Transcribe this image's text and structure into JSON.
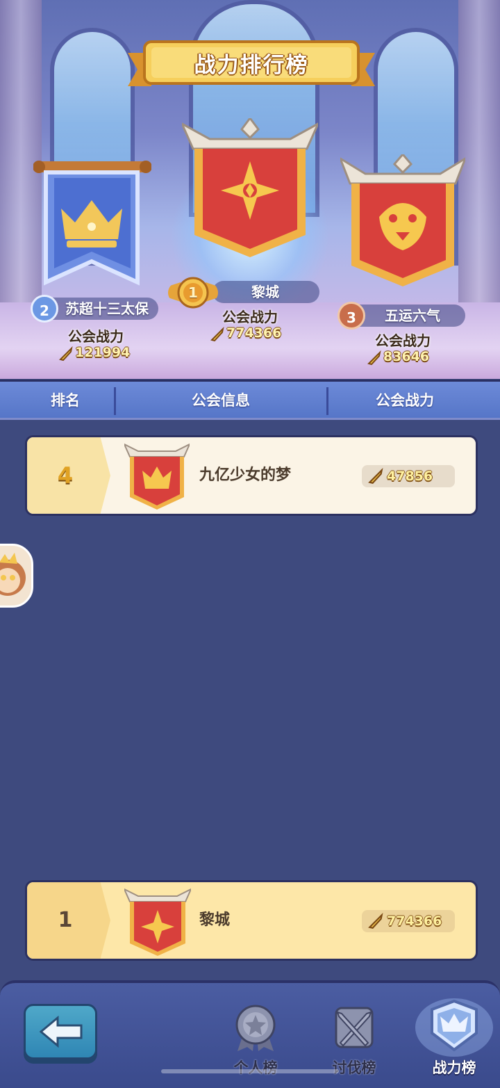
{
  "title": "战力排行榜",
  "podium": [
    {
      "rank": "2",
      "name": "苏超十三太保",
      "power_label": "公会战力",
      "power": "121994"
    },
    {
      "rank": "1",
      "name": "黎城",
      "power_label": "公会战力",
      "power": "774366"
    },
    {
      "rank": "3",
      "name": "五运六气",
      "power_label": "公会战力",
      "power": "83646"
    }
  ],
  "header": {
    "rank": "排名",
    "info": "公会信息",
    "power": "公会战力"
  },
  "rows": [
    {
      "rank": "4",
      "name": "九亿少女的梦",
      "power": "47856"
    }
  ],
  "my_row": {
    "rank": "1",
    "name": "黎城",
    "power": "774366"
  },
  "nav": {
    "tabs": [
      {
        "label": "个人榜",
        "icon": "star-medal-icon"
      },
      {
        "label": "讨伐榜",
        "icon": "crossed-swords-icon"
      },
      {
        "label": "战力榜",
        "icon": "crown-shield-icon"
      }
    ],
    "active": "战力榜"
  },
  "colors": {
    "banner_red": "#d8403c",
    "banner_blue": "#4d6fd1",
    "gold": "#f2c75a",
    "bg": "#3e4a7e"
  }
}
